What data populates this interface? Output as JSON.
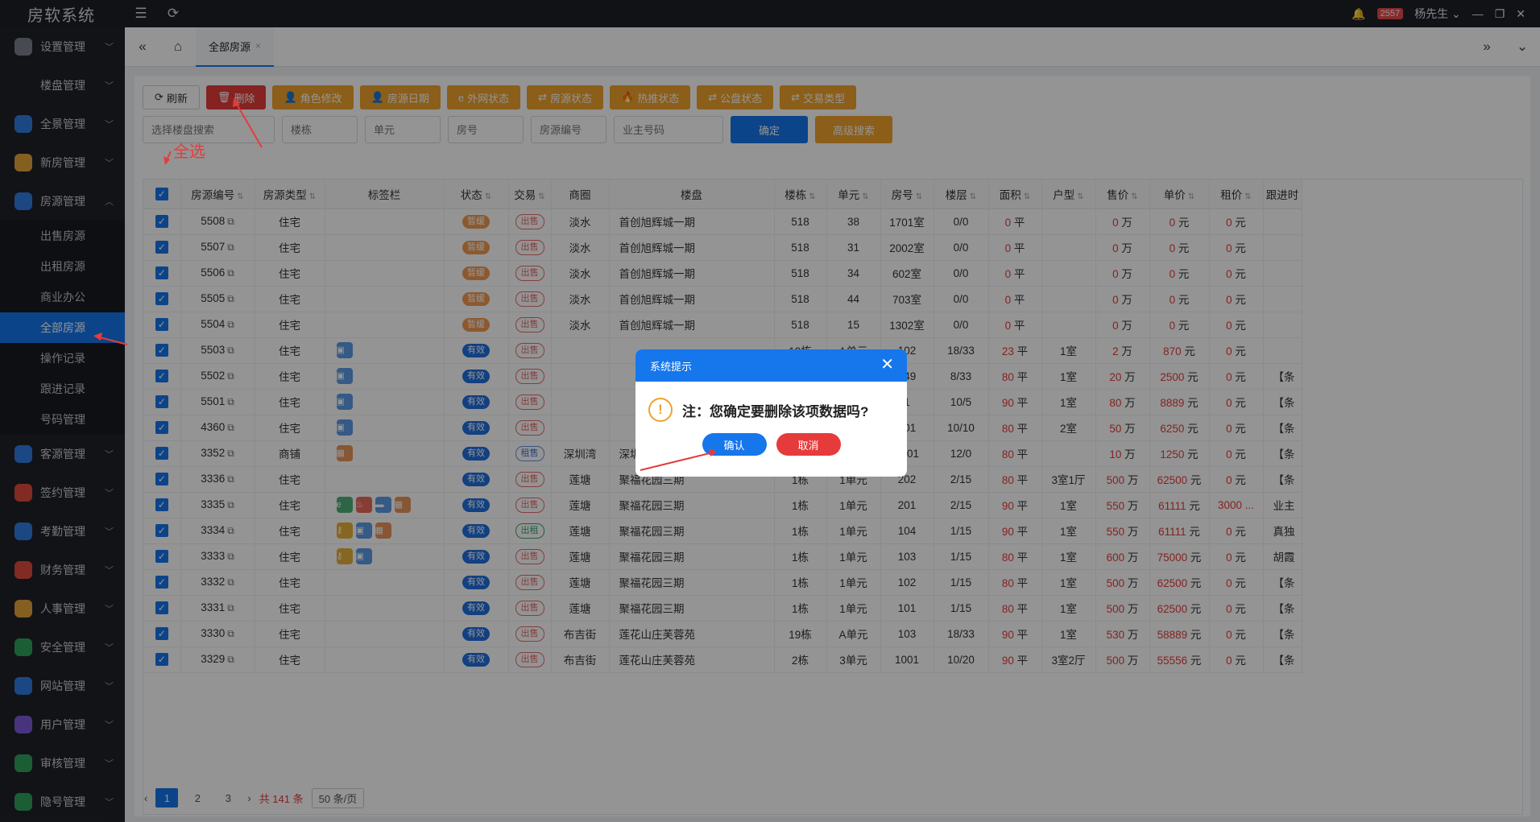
{
  "app": {
    "title": "房软系统",
    "notif_count": "2557",
    "user": "杨先生"
  },
  "sidebar": {
    "items": [
      {
        "label": "设置管理",
        "icon": "gear-icon",
        "color": "#7a808a"
      },
      {
        "label": "楼盘管理",
        "icon": "",
        "color": ""
      },
      {
        "label": "全景管理",
        "icon": "panorama-icon",
        "color": "#2f7de1"
      },
      {
        "label": "新房管理",
        "icon": "house-icon",
        "color": "#e6a23c"
      },
      {
        "label": "房源管理",
        "icon": "home-icon",
        "color": "#2f7de1"
      }
    ],
    "subitems": [
      "出售房源",
      "出租房源",
      "商业办公",
      "全部房源",
      "操作记录",
      "跟进记录",
      "号码管理"
    ],
    "items2": [
      {
        "label": "客源管理",
        "icon": "user-icon",
        "color": "#2f7de1"
      },
      {
        "label": "签约管理",
        "icon": "contract-icon",
        "color": "#e04a3b"
      },
      {
        "label": "考勤管理",
        "icon": "clock-icon",
        "color": "#2f7de1"
      },
      {
        "label": "财务管理",
        "icon": "finance-icon",
        "color": "#e04a3b"
      },
      {
        "label": "人事管理",
        "icon": "org-icon",
        "color": "#e6a23c"
      },
      {
        "label": "安全管理",
        "icon": "shield-icon",
        "color": "#2fa35c"
      },
      {
        "label": "网站管理",
        "icon": "web-icon",
        "color": "#2f7de1"
      },
      {
        "label": "用户管理",
        "icon": "users-icon",
        "color": "#7b5ad6"
      },
      {
        "label": "审核管理",
        "icon": "audit-icon",
        "color": "#2fa35c"
      },
      {
        "label": "隐号管理",
        "icon": "phone-icon",
        "color": "#2fa35c"
      }
    ]
  },
  "tabs": {
    "active": "全部房源"
  },
  "toolbar": {
    "refresh": "刷新",
    "delete": "删除",
    "role": "角色修改",
    "date": "房源日期",
    "web": "外网状态",
    "status": "房源状态",
    "hot": "热推状态",
    "public": "公盘状态",
    "trade": "交易类型"
  },
  "filters": {
    "estate": "选择楼盘搜索",
    "building": "楼栋",
    "unit": "单元",
    "room": "房号",
    "code": "房源编号",
    "phone": "业主号码",
    "confirm": "确定",
    "advanced": "高级搜索"
  },
  "table": {
    "headers": [
      "房源编号",
      "房源类型",
      "标签栏",
      "状态",
      "交易",
      "商圈",
      "楼盘",
      "楼栋",
      "单元",
      "房号",
      "楼层",
      "面积",
      "户型",
      "售价",
      "单价",
      "租价",
      "跟进时"
    ],
    "rows": [
      {
        "id": "5508",
        "type": "住宅",
        "tags": [],
        "status": "暂缓",
        "trade": "出售",
        "area": "淡水",
        "estate": "首创旭辉城一期",
        "bld": "518",
        "unit": "38",
        "room": "1701室",
        "floor": "0/0",
        "size": "0",
        "layout": "",
        "price": "0",
        "unitp": "0",
        "rent": "0",
        "fol": ""
      },
      {
        "id": "5507",
        "type": "住宅",
        "tags": [],
        "status": "暂缓",
        "trade": "出售",
        "area": "淡水",
        "estate": "首创旭辉城一期",
        "bld": "518",
        "unit": "31",
        "room": "2002室",
        "floor": "0/0",
        "size": "0",
        "layout": "",
        "price": "0",
        "unitp": "0",
        "rent": "0",
        "fol": ""
      },
      {
        "id": "5506",
        "type": "住宅",
        "tags": [],
        "status": "暂缓",
        "trade": "出售",
        "area": "淡水",
        "estate": "首创旭辉城一期",
        "bld": "518",
        "unit": "34",
        "room": "602室",
        "floor": "0/0",
        "size": "0",
        "layout": "",
        "price": "0",
        "unitp": "0",
        "rent": "0",
        "fol": ""
      },
      {
        "id": "5505",
        "type": "住宅",
        "tags": [],
        "status": "暂缓",
        "trade": "出售",
        "area": "淡水",
        "estate": "首创旭辉城一期",
        "bld": "518",
        "unit": "44",
        "room": "703室",
        "floor": "0/0",
        "size": "0",
        "layout": "",
        "price": "0",
        "unitp": "0",
        "rent": "0",
        "fol": ""
      },
      {
        "id": "5504",
        "type": "住宅",
        "tags": [],
        "status": "暂缓",
        "trade": "出售",
        "area": "淡水",
        "estate": "首创旭辉城一期",
        "bld": "518",
        "unit": "15",
        "room": "1302室",
        "floor": "0/0",
        "size": "0",
        "layout": "",
        "price": "0",
        "unitp": "0",
        "rent": "0",
        "fol": ""
      },
      {
        "id": "5503",
        "type": "住宅",
        "tags": [
          "img"
        ],
        "status": "有效",
        "trade": "出售",
        "area": "",
        "estate": "",
        "bld": "19栋",
        "unit": "A单元",
        "room": "102",
        "floor": "18/33",
        "size": "23",
        "layout": "1室",
        "price": "2",
        "unitp": "870",
        "rent": "0",
        "fol": ""
      },
      {
        "id": "5502",
        "type": "住宅",
        "tags": [
          "img"
        ],
        "status": "有效",
        "trade": "出售",
        "area": "",
        "estate": "",
        "bld": "19栋",
        "unit": "A单元",
        "room": "849",
        "floor": "8/33",
        "size": "80",
        "layout": "1室",
        "price": "20",
        "unitp": "2500",
        "rent": "0",
        "fol": "【条"
      },
      {
        "id": "5501",
        "type": "住宅",
        "tags": [
          "img"
        ],
        "status": "有效",
        "trade": "出售",
        "area": "",
        "estate": "",
        "bld": "0栋",
        "unit": "0单元",
        "room": "1",
        "floor": "10/5",
        "size": "90",
        "layout": "1室",
        "price": "80",
        "unitp": "8889",
        "rent": "0",
        "fol": "【条"
      },
      {
        "id": "4360",
        "type": "住宅",
        "tags": [
          "img"
        ],
        "status": "有效",
        "trade": "出售",
        "area": "",
        "estate": "",
        "bld": "A栋",
        "unit": "1单元",
        "room": "101",
        "floor": "10/10",
        "size": "80",
        "layout": "2室",
        "price": "50",
        "unitp": "6250",
        "rent": "0",
        "fol": "【条"
      },
      {
        "id": "3352",
        "type": "商铺",
        "tags": [
          "shop"
        ],
        "status": "有效",
        "trade": "租售",
        "area": "深圳湾",
        "estate": "深圳湾1号",
        "bld": "0",
        "unit": "",
        "room": "1201",
        "floor": "12/0",
        "size": "80",
        "layout": "",
        "price": "10",
        "unitp": "1250",
        "rent": "0",
        "fol": "【条"
      },
      {
        "id": "3336",
        "type": "住宅",
        "tags": [],
        "status": "有效",
        "trade": "出售",
        "area": "莲塘",
        "estate": "聚福花园三期",
        "bld": "1栋",
        "unit": "1单元",
        "room": "202",
        "floor": "2/15",
        "size": "80",
        "layout": "3室1厅",
        "price": "500",
        "unitp": "62500",
        "rent": "0",
        "fol": "【条"
      },
      {
        "id": "3335",
        "type": "住宅",
        "tags": [
          "edu",
          "fire",
          "car",
          "shop"
        ],
        "status": "有效",
        "trade": "出售",
        "area": "莲塘",
        "estate": "聚福花园三期",
        "bld": "1栋",
        "unit": "1单元",
        "room": "201",
        "floor": "2/15",
        "size": "90",
        "layout": "1室",
        "price": "550",
        "unitp": "61111",
        "rent": "3000 ...",
        "fol": "业主"
      },
      {
        "id": "3334",
        "type": "住宅",
        "tags": [
          "key",
          "img",
          "shop"
        ],
        "status": "有效",
        "trade": "出租",
        "area": "莲塘",
        "estate": "聚福花园三期",
        "bld": "1栋",
        "unit": "1单元",
        "room": "104",
        "floor": "1/15",
        "size": "90",
        "layout": "1室",
        "price": "550",
        "unitp": "61111",
        "rent": "0",
        "fol": "真独"
      },
      {
        "id": "3333",
        "type": "住宅",
        "tags": [
          "key",
          "img"
        ],
        "status": "有效",
        "trade": "出售",
        "area": "莲塘",
        "estate": "聚福花园三期",
        "bld": "1栋",
        "unit": "1单元",
        "room": "103",
        "floor": "1/15",
        "size": "80",
        "layout": "1室",
        "price": "600",
        "unitp": "75000",
        "rent": "0",
        "fol": "胡霞"
      },
      {
        "id": "3332",
        "type": "住宅",
        "tags": [],
        "status": "有效",
        "trade": "出售",
        "area": "莲塘",
        "estate": "聚福花园三期",
        "bld": "1栋",
        "unit": "1单元",
        "room": "102",
        "floor": "1/15",
        "size": "80",
        "layout": "1室",
        "price": "500",
        "unitp": "62500",
        "rent": "0",
        "fol": "【条"
      },
      {
        "id": "3331",
        "type": "住宅",
        "tags": [],
        "status": "有效",
        "trade": "出售",
        "area": "莲塘",
        "estate": "聚福花园三期",
        "bld": "1栋",
        "unit": "1单元",
        "room": "101",
        "floor": "1/15",
        "size": "80",
        "layout": "1室",
        "price": "500",
        "unitp": "62500",
        "rent": "0",
        "fol": "【条"
      },
      {
        "id": "3330",
        "type": "住宅",
        "tags": [],
        "status": "有效",
        "trade": "出售",
        "area": "布吉街",
        "estate": "莲花山庄芙蓉苑",
        "bld": "19栋",
        "unit": "A单元",
        "room": "103",
        "floor": "18/33",
        "size": "90",
        "layout": "1室",
        "price": "530",
        "unitp": "58889",
        "rent": "0",
        "fol": "【条"
      },
      {
        "id": "3329",
        "type": "住宅",
        "tags": [],
        "status": "有效",
        "trade": "出售",
        "area": "布吉街",
        "estate": "莲花山庄芙蓉苑",
        "bld": "2栋",
        "unit": "3单元",
        "room": "1001",
        "floor": "10/20",
        "size": "90",
        "layout": "3室2厅",
        "price": "500",
        "unitp": "55556",
        "rent": "0",
        "fol": "【条"
      }
    ],
    "unit_area": "平",
    "unit_price": "万",
    "unit_yuan": "元"
  },
  "pager": {
    "pages": [
      "1",
      "2",
      "3"
    ],
    "total": "共 141 条",
    "size": "50 条/页"
  },
  "dialog": {
    "title": "系统提示",
    "message": "注：您确定要删除该项数据吗?",
    "ok": "确认",
    "cancel": "取消"
  },
  "annotation": {
    "select_all": "全选"
  }
}
